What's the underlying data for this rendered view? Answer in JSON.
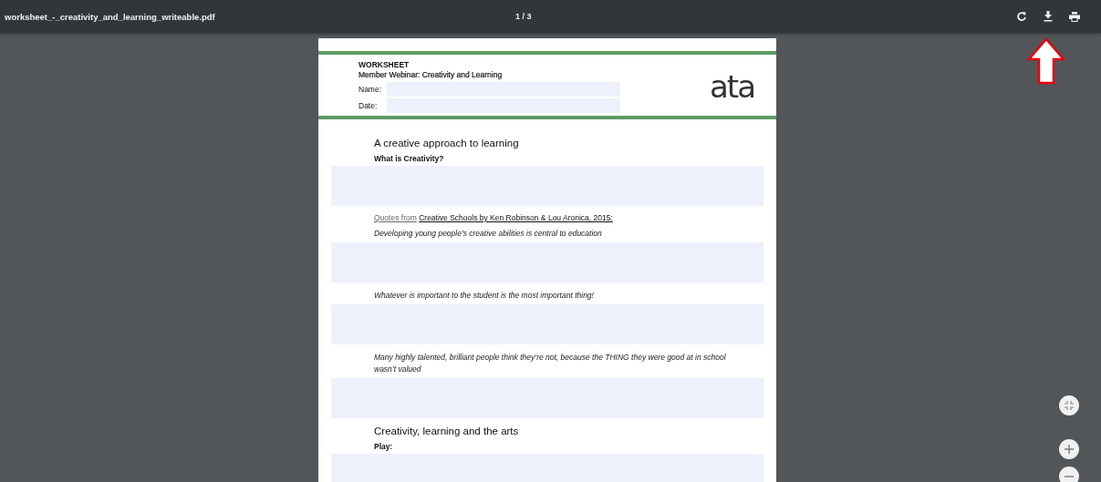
{
  "toolbar": {
    "title": "worksheet_-_creativity_and_learning_writeable.pdf",
    "page_indicator": "1 / 3"
  },
  "header": {
    "label": "WORKSHEET",
    "subtitle": "Member Webinar: Creativity and Learning",
    "fields": [
      {
        "label": "Name:"
      },
      {
        "label": "Date:"
      }
    ],
    "logo": "ata"
  },
  "content": [
    {
      "kind": "heading",
      "text": "A creative approach to learning"
    },
    {
      "kind": "subheading",
      "text": "What is Creativity?"
    },
    {
      "kind": "answer"
    },
    {
      "kind": "source",
      "prefix": "Quotes from",
      "text": "Creative Schools by Ken Robinson & Lou Aronica, 2015:"
    },
    {
      "kind": "quote",
      "text": "Developing young people’s creative abilities is central to education"
    },
    {
      "kind": "answer"
    },
    {
      "kind": "quote",
      "text": " Whatever is important to the student is the most important thing!"
    },
    {
      "kind": "answer"
    },
    {
      "kind": "quote",
      "text": "Many highly talented, brilliant people think they’re not, because the THING they were good at in school wasn’t valued"
    },
    {
      "kind": "answer"
    },
    {
      "kind": "heading",
      "text": "Creativity, learning and the arts"
    },
    {
      "kind": "subheading",
      "text": "Play:"
    },
    {
      "kind": "answer"
    }
  ]
}
